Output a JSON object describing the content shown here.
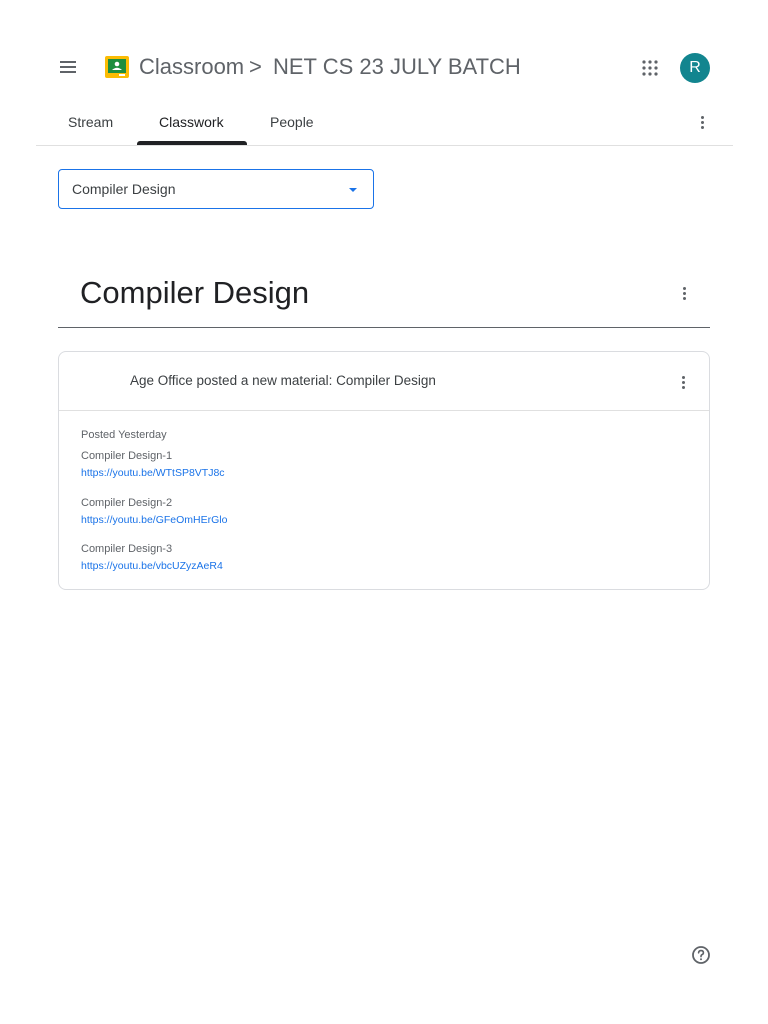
{
  "header": {
    "app_title": "Classroom",
    "separator": ">",
    "class_name": "NET CS 23 JULY BATCH",
    "avatar_letter": "R",
    "avatar_color": "#12858f",
    "icons": [
      "menu-icon",
      "classroom-logo-icon",
      "apps-grid-icon"
    ]
  },
  "tabs": [
    {
      "label": "Stream",
      "active": false
    },
    {
      "label": "Classwork",
      "active": true
    },
    {
      "label": "People",
      "active": false
    }
  ],
  "topic_filter": {
    "selected": "Compiler Design",
    "accent_color": "#1a73e8"
  },
  "topic": {
    "title": "Compiler Design"
  },
  "post": {
    "title": "Age Office posted a new material: Compiler Design",
    "posted": "Posted Yesterday",
    "materials": [
      {
        "name": "Compiler Design-1",
        "link": "https://youtu.be/WTtSP8VTJ8c"
      },
      {
        "name": "Compiler Design-2",
        "link": "https://youtu.be/GFeOmHErGlo"
      },
      {
        "name": "Compiler Design-3",
        "link": "https://youtu.be/vbcUZyzAeR4"
      }
    ]
  },
  "colors": {
    "link": "#1a73e8",
    "logo_green": "#1e8e3e",
    "logo_yellow": "#fbbc04"
  }
}
